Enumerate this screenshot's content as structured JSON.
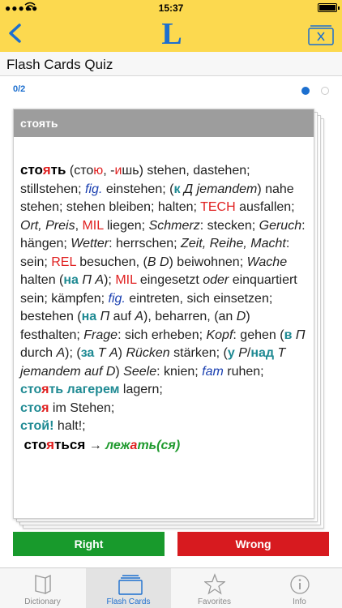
{
  "status": {
    "time": "15:37"
  },
  "header": {
    "logo": "L"
  },
  "title": "Flash Cards Quiz",
  "progress": {
    "counter": "0/2",
    "page_index": 1,
    "page_count": 2
  },
  "card": {
    "word": "стоять",
    "entry": {
      "hw_a": "сто",
      "hw_b": "я",
      "hw_c": "ть",
      "t01": " (сто",
      "t02": "ю",
      "t03": ", -",
      "t04": "и",
      "t05": "шь) stehen, dastehen; stillstehen; ",
      "t06": "fig.",
      "t07": " einstehen; (",
      "t08": "к",
      "t09": " Д jemandem",
      "t10": ") nahe stehen; stehen bleiben; halten; ",
      "t11": "TECH",
      "t12": " ausfallen; ",
      "t13": "Ort, Preis",
      "t14": ", ",
      "t15": "MIL",
      "t16": " liegen; ",
      "t17": "Schmerz",
      "t18": ": stecken; ",
      "t19": "Geruch",
      "t20": ": hängen; ",
      "t21": "Wetter",
      "t22": ": herrschen; ",
      "t23": "Zeit, Reihe, Macht",
      "t24": ": sein; ",
      "t25": "REL",
      "t26": " besuchen, (",
      "t27": "В D",
      "t28": ") beiwohnen; ",
      "t29": "Wache",
      "t30": " halten (",
      "t31": "на",
      "t32": " П А",
      "t33": "); ",
      "t34": "MIL",
      "t35": " eingesetzt ",
      "t36": "oder",
      "t37": " einquartiert sein; kämpfen; ",
      "t38": "fig.",
      "t39": " eintreten, sich einsetzen; bestehen (",
      "t40": "на",
      "t41": " П",
      "t42": " auf ",
      "t43": "A",
      "t44": "), beharren, (an ",
      "t45": "D",
      "t46": ") festhalten; ",
      "t47": "Frage",
      "t48": ": sich erheben; ",
      "t49": "Kopf",
      "t50": ": gehen (",
      "t51": "в",
      "t52": " П",
      "t53": " durch ",
      "t54": "A",
      "t55": "); (",
      "t56": "за",
      "t57": " Т A",
      "t58": ") ",
      "t59": "Rücken",
      "t60": " stärken; (",
      "t61": "у",
      "t62": " Р",
      "t63": "/",
      "t64": "над",
      "t65": " Т jemandem auf D",
      "t66": ") ",
      "t67": "Seele",
      "t68": ": knien; ",
      "t69": "fam",
      "t70": " ruhen;",
      "p1a": "сто",
      "p1b": "я",
      "p1c": "ть лагерем",
      "p1d": " lagern;",
      "p2a": "сто",
      "p2b": "я",
      "p2c": " im Stehen;",
      "p3a": "стой!",
      "p3b": " halt!;",
      "hw2_a": "сто",
      "hw2_b": "я",
      "hw2_c": "ться",
      "arrow": " → ",
      "ref_a": "леж",
      "ref_b": "а",
      "ref_c": "ть(ся)"
    }
  },
  "buttons": {
    "right": "Right",
    "wrong": "Wrong"
  },
  "tabs": [
    {
      "label": "Dictionary",
      "icon": "book-icon"
    },
    {
      "label": "Flash Cards",
      "icon": "flash-cards-icon"
    },
    {
      "label": "Favorites",
      "icon": "star-icon"
    },
    {
      "label": "Info",
      "icon": "info-icon"
    }
  ],
  "colors": {
    "header": "#fcd94f",
    "accent": "#1c6fcf",
    "right": "#189a2c",
    "wrong": "#d71a1f"
  }
}
